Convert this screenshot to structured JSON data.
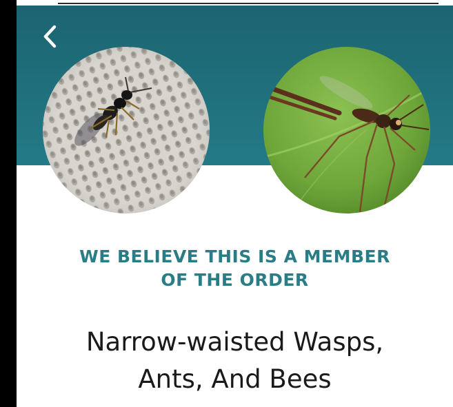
{
  "header": {
    "back_icon": "chevron-left-icon",
    "band_color": "#1d6a76"
  },
  "photos": [
    {
      "subject": "small black wasp on mesh fabric"
    },
    {
      "subject": "long-legged wasp on green leaf"
    }
  ],
  "result": {
    "caption_line1": "WE BELIEVE THIS IS A MEMBER",
    "caption_line2": "OF THE ORDER",
    "caption_color": "#2a7d86",
    "name_line1": "Narrow-waisted Wasps,",
    "name_line2": "Ants, And Bees"
  }
}
